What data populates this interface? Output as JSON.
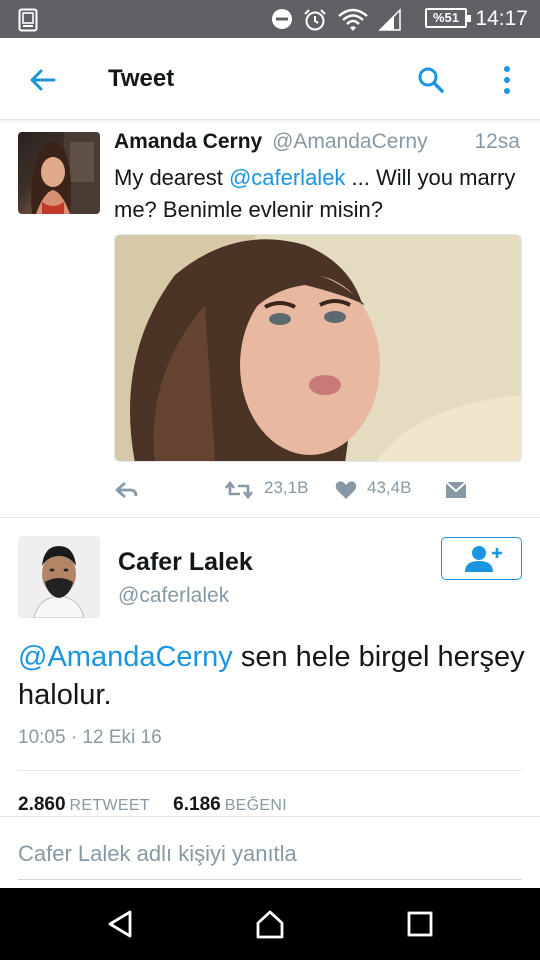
{
  "status_bar": {
    "time": "14:17",
    "battery": "%51",
    "icons": [
      "screenshot-icon",
      "do-not-disturb-icon",
      "alarm-icon",
      "wifi-icon",
      "signal-icon",
      "battery-icon"
    ]
  },
  "toolbar": {
    "title": "Tweet",
    "back_icon": "arrow-left-icon",
    "search_icon": "search-icon",
    "menu_icon": "more-vertical-icon"
  },
  "tweet1": {
    "name": "Amanda Cerny",
    "handle": "@AmandaCerny",
    "time": "12sa",
    "text_before": "My dearest ",
    "mention": "@caferlalek",
    "text_after": " ... Will you marry me? Benimle evlenir misin?",
    "retweets": "23,1B",
    "likes": "43,4B"
  },
  "tweet2": {
    "name": "Cafer Lalek",
    "handle": "@caferlalek",
    "mention": "@AmandaCerny",
    "text": " sen hele birgel herşey halolur.",
    "timestamp": "10:05 · 12 Eki 16",
    "retweet_count": "2.860",
    "retweet_label": "RETWEET",
    "like_count": "6.186",
    "like_label": "BEĞENI"
  },
  "reply": {
    "placeholder": "Cafer Lalek adlı kişiyi yanıtla"
  },
  "colors": {
    "accent": "#1b95e0",
    "status_bar": "#5e6066",
    "muted": "#8899a6"
  }
}
